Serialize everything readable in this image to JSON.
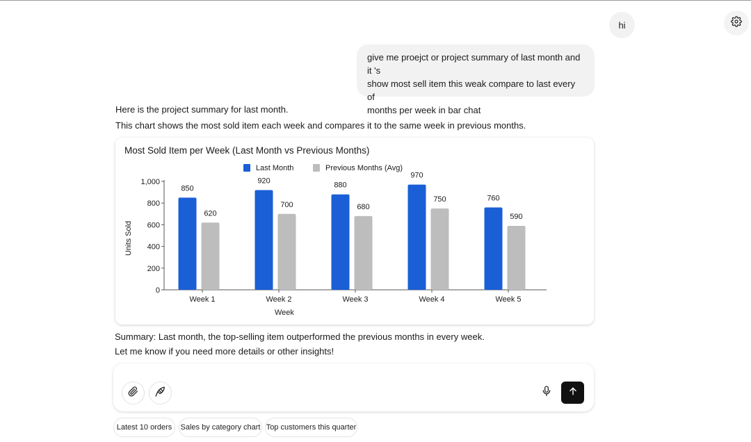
{
  "conversation": {
    "user_messages": [
      "hi",
      [
        "give me proejct or project summary of last month and it 's",
        "show most sell item this weak compare to last every of",
        "months per week in bar chat"
      ]
    ],
    "response_intro": [
      "Here is the project summary for last month.",
      "This chart shows the most sold item each week and compares it to the same week in previous months."
    ],
    "response_outro": [
      "Summary: Last month, the top-selling item outperformed the previous months in every week.",
      "Let me know if you need more details or other insights!"
    ]
  },
  "chart_data": {
    "type": "bar",
    "title": "Most Sold Item per Week (Last Month vs Previous Months)",
    "xlabel": "Week",
    "ylabel": "Units Sold",
    "categories": [
      "Week 1",
      "Week 2",
      "Week 3",
      "Week 4",
      "Week 5"
    ],
    "series": [
      {
        "name": "Last Month",
        "color": "#1a5fd6",
        "values": [
          850,
          920,
          880,
          970,
          760
        ]
      },
      {
        "name": "Previous Months (Avg)",
        "color": "#bdbdbd",
        "values": [
          620,
          700,
          680,
          750,
          590
        ]
      }
    ],
    "ylim": [
      0,
      1000
    ],
    "yticks": [
      0,
      200,
      400,
      600,
      800,
      1000
    ],
    "ytick_labels": [
      "0",
      "200",
      "400",
      "600",
      "800",
      "1,000"
    ],
    "grid": false,
    "legend": "top-center",
    "data_labels": true
  },
  "composer": {
    "attach_icon": "paperclip-icon",
    "tools_icon": "quill-icon",
    "mic_icon": "microphone-icon",
    "send_icon": "arrow-up-icon"
  },
  "suggestions": [
    "Latest 10 orders",
    "Sales by category chart",
    "Top customers this quarter"
  ],
  "settings_icon": "gear-icon"
}
